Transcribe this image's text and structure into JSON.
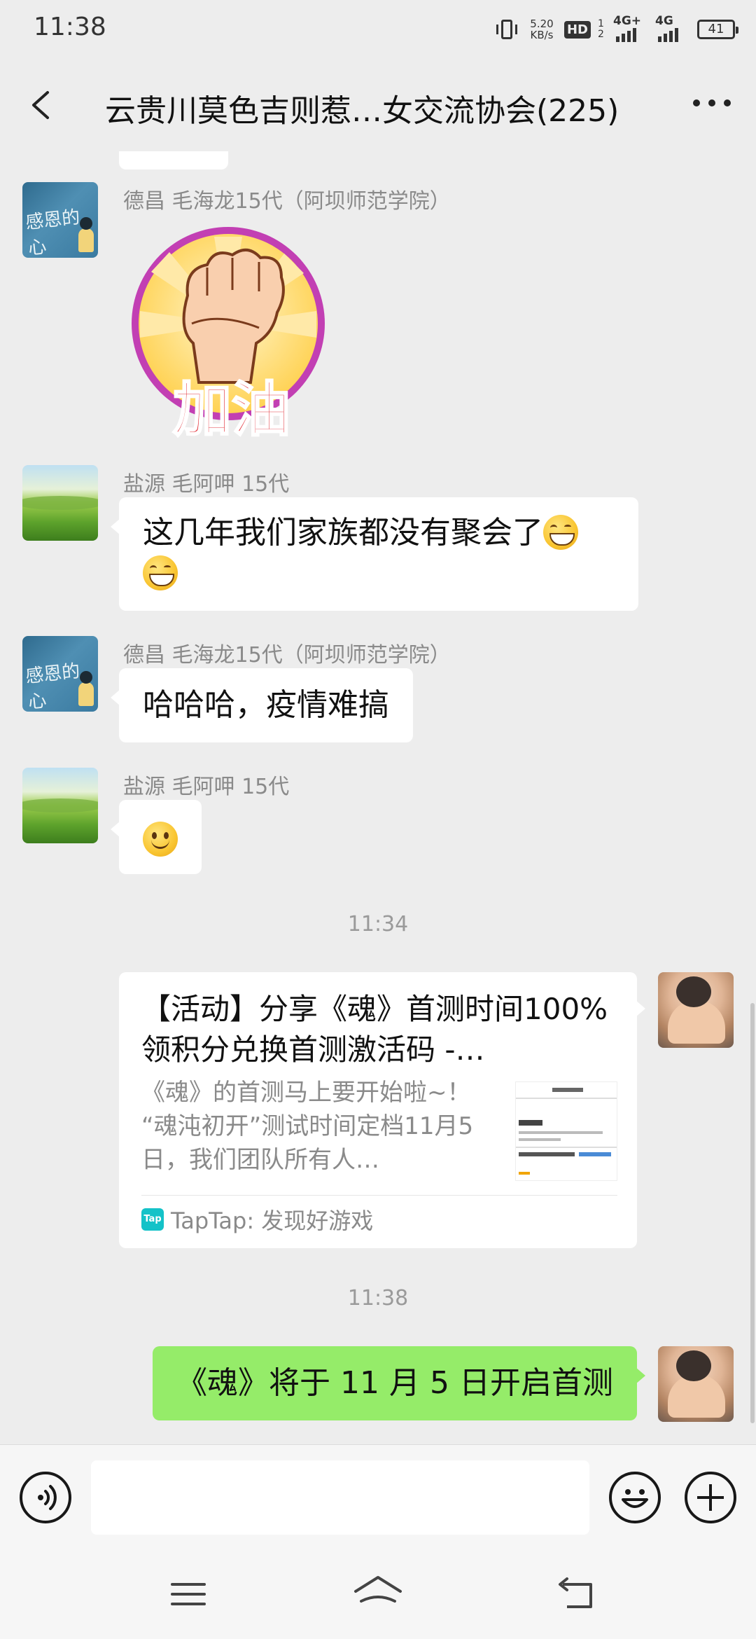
{
  "status_bar": {
    "time": "11:38",
    "net_speed_value": "5.20",
    "net_speed_unit": "KB/s",
    "hd_label": "HD",
    "sim_label": "1 2",
    "network1": "4G+",
    "network2": "4G",
    "battery": "41"
  },
  "header": {
    "title": "云贵川莫色吉则惹…女交流协会(225)"
  },
  "messages": [
    {
      "sender": "德昌  毛海龙15代（阿坝师范学院）",
      "type": "sticker",
      "sticker_text": "加油",
      "avatar": "thanks-avatar"
    },
    {
      "sender": "盐源  毛阿呷  15代",
      "type": "text",
      "text": "这几年我们家族都没有聚会了",
      "avatar": "meadow-avatar"
    },
    {
      "sender": "德昌  毛海龙15代（阿坝师范学院）",
      "type": "text",
      "text": "哈哈哈，疫情难搞",
      "avatar": "thanks-avatar"
    },
    {
      "sender": "盐源  毛阿呷  15代",
      "type": "emoji",
      "avatar": "meadow-avatar"
    }
  ],
  "time_labels": [
    "11:34",
    "11:38"
  ],
  "link_card": {
    "title": "【活动】分享《魂》首测时间100%领积分兑换首测激活码 -…",
    "description": "《魂》的首测马上要开始啦~！ “魂沌初开”测试时间定档11月5日，我们团队所有人…",
    "source_icon": "Tap",
    "source": "TapTap: 发现好游戏"
  },
  "my_message": {
    "text": "《魂》将于 11 月 5 日开启首测"
  },
  "input_bar": {
    "placeholder": ""
  },
  "colors": {
    "background": "#ededed",
    "my_bubble": "#95ec69",
    "other_bubble": "#ffffff",
    "taptap": "#14c2c8"
  }
}
